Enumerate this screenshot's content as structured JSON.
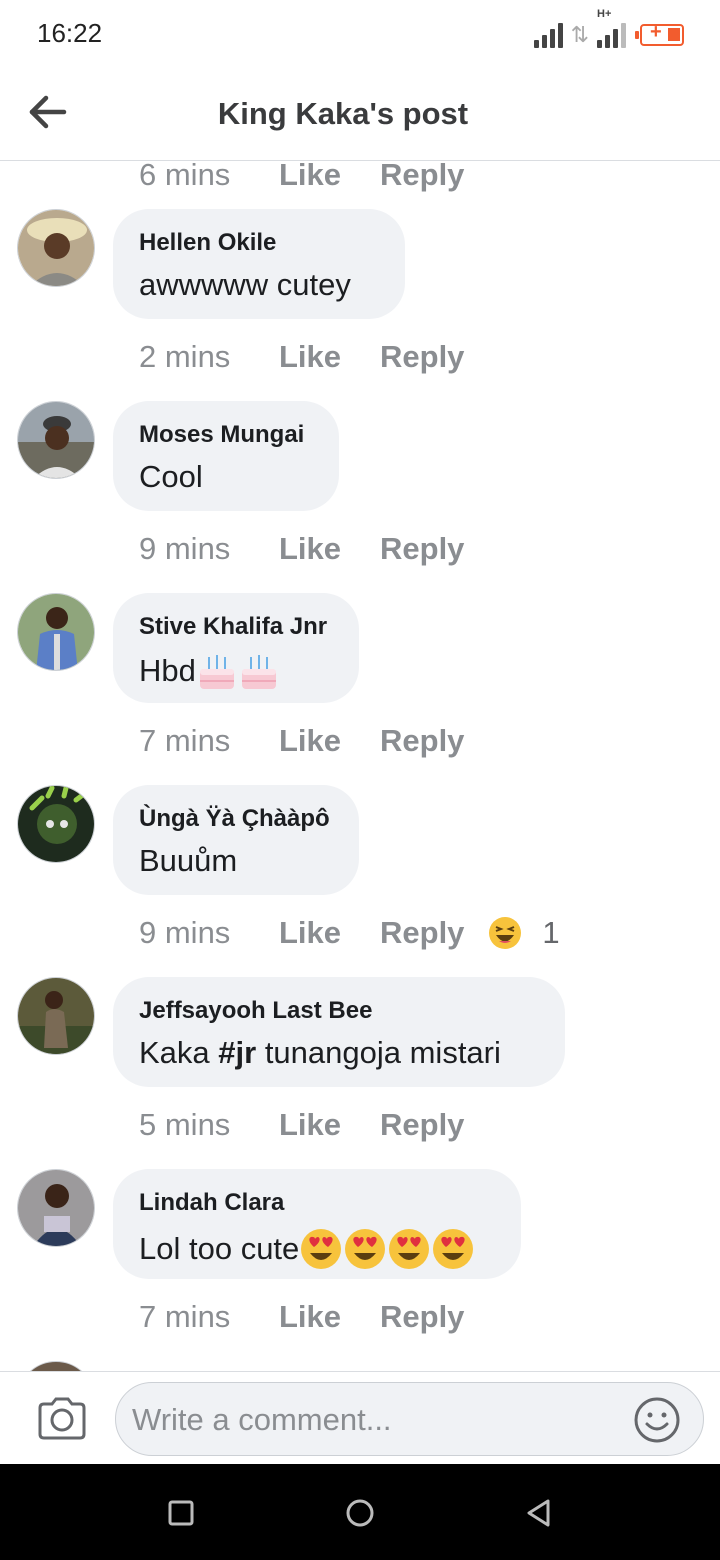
{
  "status_bar": {
    "time": "16:22",
    "network_label": "H+"
  },
  "header": {
    "title": "King Kaka's post",
    "back_icon": "arrow-left-icon"
  },
  "partial_meta": {
    "time": "6 mins",
    "like": "Like",
    "reply": "Reply"
  },
  "comments": [
    {
      "author": "Hellen Okile",
      "text": "awwwww cutey",
      "time": "2 mins",
      "like": "Like",
      "reply": "Reply"
    },
    {
      "author": "Moses Mungai",
      "text": "Cool",
      "time": "9 mins",
      "like": "Like",
      "reply": "Reply"
    },
    {
      "author": "Stive Khalifa Jnr",
      "text": "Hbd",
      "emoji": "birthday-cake-emoji",
      "emoji_count": 2,
      "time": "7 mins",
      "like": "Like",
      "reply": "Reply"
    },
    {
      "author": "Ùngà Ÿà Çhààpô",
      "text": "Buuům",
      "time": "9 mins",
      "like": "Like",
      "reply": "Reply",
      "reaction": {
        "icon": "haha-reaction-icon",
        "count": "1"
      }
    },
    {
      "author": "Jeffsayooh Last Bee",
      "text_before": "Kaka ",
      "text_bold": "#jr",
      "text_after": " tunangoja mistari",
      "time": "5 mins",
      "like": "Like",
      "reply": "Reply"
    },
    {
      "author": "Lindah Clara",
      "text": "Lol too cute",
      "emoji": "heart-eyes-emoji",
      "emoji_count": 4,
      "time": "7 mins",
      "like": "Like",
      "reply": "Reply"
    }
  ],
  "composer": {
    "placeholder": "Write a comment..."
  },
  "colors": {
    "bubble": "#f0f2f5",
    "meta_text": "#8a8d91",
    "battery": "#f25c2e"
  }
}
